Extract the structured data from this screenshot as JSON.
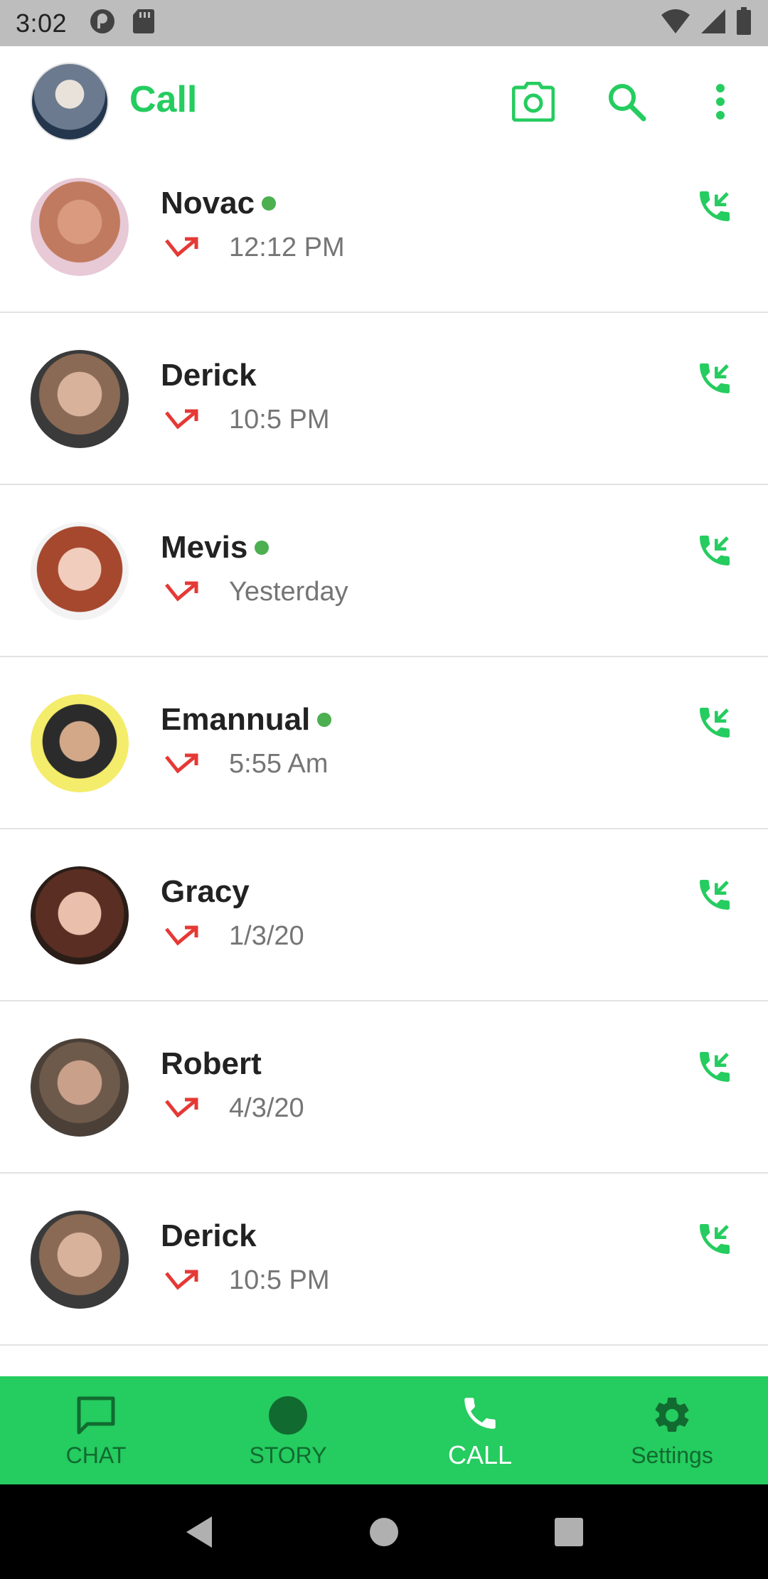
{
  "status_bar": {
    "time": "3:02"
  },
  "app_bar": {
    "title": "Call"
  },
  "calls": [
    {
      "name": "Novac",
      "online": true,
      "time": "12:12 PM"
    },
    {
      "name": "Derick",
      "online": false,
      "time": "10:5 PM"
    },
    {
      "name": "Mevis",
      "online": true,
      "time": "Yesterday"
    },
    {
      "name": "Emannual",
      "online": true,
      "time": "5:55 Am"
    },
    {
      "name": "Gracy",
      "online": false,
      "time": "1/3/20"
    },
    {
      "name": "Robert",
      "online": false,
      "time": "4/3/20"
    },
    {
      "name": "Derick",
      "online": false,
      "time": "10:5 PM"
    }
  ],
  "bottom_nav": [
    {
      "label": "CHAT",
      "icon": "chat-icon",
      "active": false
    },
    {
      "label": "STORY",
      "icon": "story-icon",
      "active": false
    },
    {
      "label": "CALL",
      "icon": "phone-icon",
      "active": true
    },
    {
      "label": "Settings",
      "icon": "gear-icon",
      "active": false
    }
  ],
  "colors": {
    "accent": "#25cc5f",
    "missed": "#e53935",
    "online": "#4caf50",
    "nav_inactive": "#116b30"
  }
}
